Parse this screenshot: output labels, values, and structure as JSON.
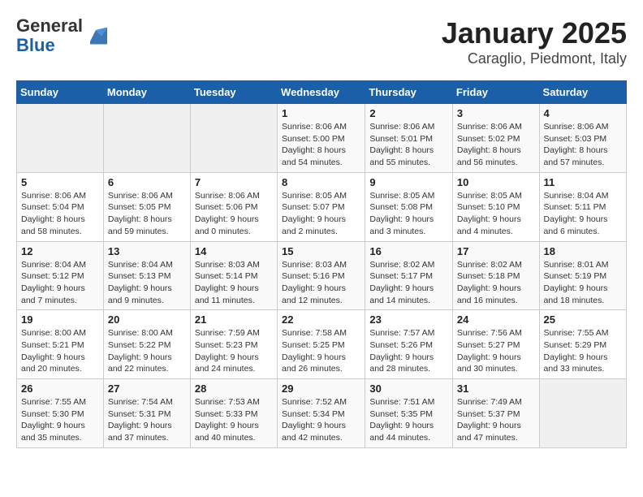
{
  "logo": {
    "general": "General",
    "blue": "Blue"
  },
  "title": "January 2025",
  "subtitle": "Caraglio, Piedmont, Italy",
  "days_header": [
    "Sunday",
    "Monday",
    "Tuesday",
    "Wednesday",
    "Thursday",
    "Friday",
    "Saturday"
  ],
  "weeks": [
    [
      {
        "day": "",
        "info": ""
      },
      {
        "day": "",
        "info": ""
      },
      {
        "day": "",
        "info": ""
      },
      {
        "day": "1",
        "info": "Sunrise: 8:06 AM\nSunset: 5:00 PM\nDaylight: 8 hours\nand 54 minutes."
      },
      {
        "day": "2",
        "info": "Sunrise: 8:06 AM\nSunset: 5:01 PM\nDaylight: 8 hours\nand 55 minutes."
      },
      {
        "day": "3",
        "info": "Sunrise: 8:06 AM\nSunset: 5:02 PM\nDaylight: 8 hours\nand 56 minutes."
      },
      {
        "day": "4",
        "info": "Sunrise: 8:06 AM\nSunset: 5:03 PM\nDaylight: 8 hours\nand 57 minutes."
      }
    ],
    [
      {
        "day": "5",
        "info": "Sunrise: 8:06 AM\nSunset: 5:04 PM\nDaylight: 8 hours\nand 58 minutes."
      },
      {
        "day": "6",
        "info": "Sunrise: 8:06 AM\nSunset: 5:05 PM\nDaylight: 8 hours\nand 59 minutes."
      },
      {
        "day": "7",
        "info": "Sunrise: 8:06 AM\nSunset: 5:06 PM\nDaylight: 9 hours\nand 0 minutes."
      },
      {
        "day": "8",
        "info": "Sunrise: 8:05 AM\nSunset: 5:07 PM\nDaylight: 9 hours\nand 2 minutes."
      },
      {
        "day": "9",
        "info": "Sunrise: 8:05 AM\nSunset: 5:08 PM\nDaylight: 9 hours\nand 3 minutes."
      },
      {
        "day": "10",
        "info": "Sunrise: 8:05 AM\nSunset: 5:10 PM\nDaylight: 9 hours\nand 4 minutes."
      },
      {
        "day": "11",
        "info": "Sunrise: 8:04 AM\nSunset: 5:11 PM\nDaylight: 9 hours\nand 6 minutes."
      }
    ],
    [
      {
        "day": "12",
        "info": "Sunrise: 8:04 AM\nSunset: 5:12 PM\nDaylight: 9 hours\nand 7 minutes."
      },
      {
        "day": "13",
        "info": "Sunrise: 8:04 AM\nSunset: 5:13 PM\nDaylight: 9 hours\nand 9 minutes."
      },
      {
        "day": "14",
        "info": "Sunrise: 8:03 AM\nSunset: 5:14 PM\nDaylight: 9 hours\nand 11 minutes."
      },
      {
        "day": "15",
        "info": "Sunrise: 8:03 AM\nSunset: 5:16 PM\nDaylight: 9 hours\nand 12 minutes."
      },
      {
        "day": "16",
        "info": "Sunrise: 8:02 AM\nSunset: 5:17 PM\nDaylight: 9 hours\nand 14 minutes."
      },
      {
        "day": "17",
        "info": "Sunrise: 8:02 AM\nSunset: 5:18 PM\nDaylight: 9 hours\nand 16 minutes."
      },
      {
        "day": "18",
        "info": "Sunrise: 8:01 AM\nSunset: 5:19 PM\nDaylight: 9 hours\nand 18 minutes."
      }
    ],
    [
      {
        "day": "19",
        "info": "Sunrise: 8:00 AM\nSunset: 5:21 PM\nDaylight: 9 hours\nand 20 minutes."
      },
      {
        "day": "20",
        "info": "Sunrise: 8:00 AM\nSunset: 5:22 PM\nDaylight: 9 hours\nand 22 minutes."
      },
      {
        "day": "21",
        "info": "Sunrise: 7:59 AM\nSunset: 5:23 PM\nDaylight: 9 hours\nand 24 minutes."
      },
      {
        "day": "22",
        "info": "Sunrise: 7:58 AM\nSunset: 5:25 PM\nDaylight: 9 hours\nand 26 minutes."
      },
      {
        "day": "23",
        "info": "Sunrise: 7:57 AM\nSunset: 5:26 PM\nDaylight: 9 hours\nand 28 minutes."
      },
      {
        "day": "24",
        "info": "Sunrise: 7:56 AM\nSunset: 5:27 PM\nDaylight: 9 hours\nand 30 minutes."
      },
      {
        "day": "25",
        "info": "Sunrise: 7:55 AM\nSunset: 5:29 PM\nDaylight: 9 hours\nand 33 minutes."
      }
    ],
    [
      {
        "day": "26",
        "info": "Sunrise: 7:55 AM\nSunset: 5:30 PM\nDaylight: 9 hours\nand 35 minutes."
      },
      {
        "day": "27",
        "info": "Sunrise: 7:54 AM\nSunset: 5:31 PM\nDaylight: 9 hours\nand 37 minutes."
      },
      {
        "day": "28",
        "info": "Sunrise: 7:53 AM\nSunset: 5:33 PM\nDaylight: 9 hours\nand 40 minutes."
      },
      {
        "day": "29",
        "info": "Sunrise: 7:52 AM\nSunset: 5:34 PM\nDaylight: 9 hours\nand 42 minutes."
      },
      {
        "day": "30",
        "info": "Sunrise: 7:51 AM\nSunset: 5:35 PM\nDaylight: 9 hours\nand 44 minutes."
      },
      {
        "day": "31",
        "info": "Sunrise: 7:49 AM\nSunset: 5:37 PM\nDaylight: 9 hours\nand 47 minutes."
      },
      {
        "day": "",
        "info": ""
      }
    ]
  ]
}
